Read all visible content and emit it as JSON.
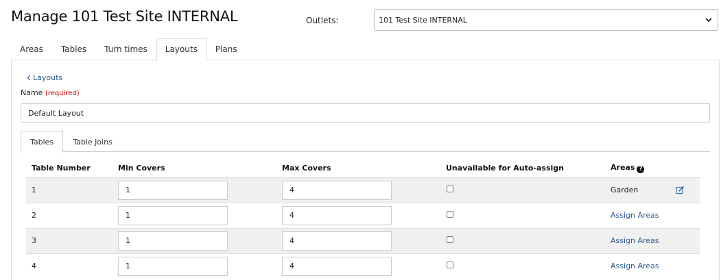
{
  "header": {
    "title": "Manage 101 Test Site INTERNAL",
    "outlets_label": "Outlets:",
    "outlets_value": "101 Test Site INTERNAL"
  },
  "main_tabs": [
    {
      "label": "Areas",
      "active": false
    },
    {
      "label": "Tables",
      "active": false
    },
    {
      "label": "Turn times",
      "active": false
    },
    {
      "label": "Layouts",
      "active": true
    },
    {
      "label": "Plans",
      "active": false
    }
  ],
  "layout_form": {
    "back_link": "Layouts",
    "name_label": "Name",
    "required_text": "(required)",
    "name_value": "Default Layout"
  },
  "sub_tabs": [
    {
      "label": "Tables",
      "active": true
    },
    {
      "label": "Table Joins",
      "active": false
    }
  ],
  "table": {
    "headers": {
      "table_number": "Table Number",
      "min_covers": "Min Covers",
      "max_covers": "Max Covers",
      "unavailable": "Unavailable for Auto-assign",
      "areas": "Areas"
    },
    "rows": [
      {
        "number": "1",
        "min": "1",
        "max": "4",
        "unavailable": false,
        "area": "Garden"
      },
      {
        "number": "2",
        "min": "1",
        "max": "4",
        "unavailable": false,
        "area": "Assign Areas"
      },
      {
        "number": "3",
        "min": "1",
        "max": "4",
        "unavailable": false,
        "area": "Assign Areas"
      },
      {
        "number": "4",
        "min": "1",
        "max": "4",
        "unavailable": false,
        "area": "Assign Areas"
      }
    ]
  },
  "colors": {
    "link": "#2b5a8c",
    "required": "#cc0000",
    "row_shade": "#f0f0f0"
  },
  "icons": [
    "chevron-down-icon",
    "chevron-left-icon",
    "help-icon",
    "edit-icon"
  ]
}
